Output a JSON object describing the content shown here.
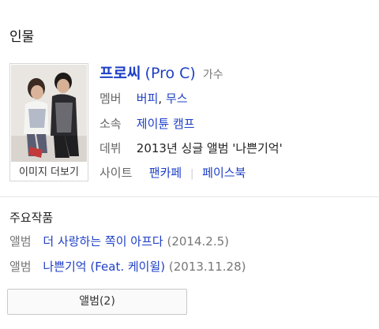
{
  "section_title": "인물",
  "profile": {
    "name_ko": "프로씨",
    "name_en": "(Pro C)",
    "role": "가수",
    "more_images": "이미지 더보기",
    "members_label": "멤버",
    "members": [
      "버피",
      "무스"
    ],
    "members_sep": ",",
    "agency_label": "소속",
    "agency": "제이튠 캠프",
    "debut_label": "데뷔",
    "debut": "2013년 싱글 앨범 '나쁜기억'",
    "site_label": "사이트",
    "sites": [
      "팬카페",
      "페이스북"
    ],
    "sites_sep": "|"
  },
  "works": {
    "title": "주요작품",
    "items": [
      {
        "label": "앨범",
        "title": "더 사랑하는 쪽이 아프다",
        "date": "(2014.2.5)"
      },
      {
        "label": "앨범",
        "title": "나쁜기억 (Feat. 케이윌)",
        "date": "(2013.11.28)"
      }
    ]
  },
  "album_button": "앨범(2)",
  "colors": {
    "link": "#1e3fc6",
    "label": "#666666",
    "divider": "#e5e5e5"
  }
}
